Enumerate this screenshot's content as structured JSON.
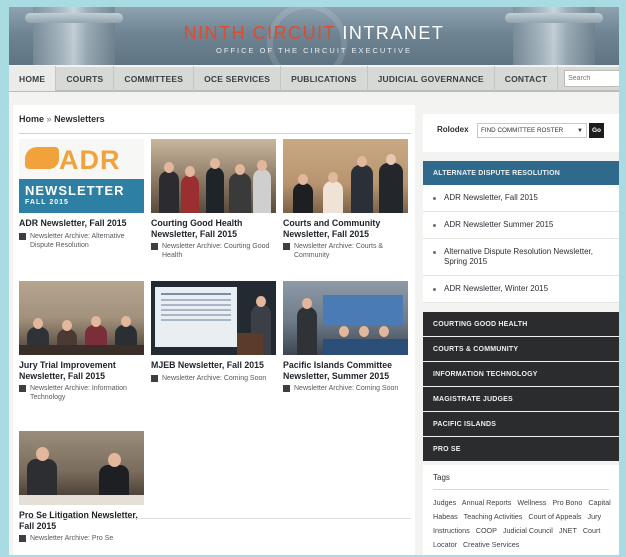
{
  "header": {
    "title_red": "NINTH CIRCUIT",
    "title_white": "INTRANET",
    "subtitle": "OFFICE OF THE CIRCUIT EXECUTIVE"
  },
  "nav": {
    "items": [
      "HOME",
      "COURTS",
      "COMMITTEES",
      "OCE SERVICES",
      "PUBLICATIONS",
      "JUDICIAL GOVERNANCE",
      "CONTACT"
    ],
    "search_placeholder": "Search"
  },
  "breadcrumb": {
    "home": "Home",
    "sep": "»",
    "current": "Newsletters"
  },
  "cards": [
    {
      "title": "ADR Newsletter, Fall 2015",
      "meta": "Newsletter Archive: Alternative Dispute Resolution",
      "thumb": {
        "adr": "ADR",
        "newsletter": "NEWSLETTER",
        "fall": "FALL 2015"
      }
    },
    {
      "title": "Courting Good Health Newsletter, Fall 2015",
      "meta": "Newsletter Archive: Courting Good Health"
    },
    {
      "title": "Courts and Community Newsletter, Fall 2015",
      "meta": "Newsletter Archive: Courts & Community"
    },
    {
      "title": "Jury Trial Improvement Newsletter, Fall 2015",
      "meta": "Newsletter Archive: Information Technology"
    },
    {
      "title": "MJEB Newsletter, Fall 2015",
      "meta": "Newsletter Archive: Coming Soon"
    },
    {
      "title": "Pacific Islands Committee Newsletter, Summer 2015",
      "meta": "Newsletter Archive: Coming Soon"
    },
    {
      "title": "Pro Se Litigation Newsletter, Fall 2015",
      "meta": "Newsletter Archive: Pro Se"
    }
  ],
  "sidebar": {
    "rolodex_label": "Rolodex",
    "rolodex_select": "FIND COMMITTEE ROSTER",
    "go": "Go",
    "open_section": "ALTERNATE DISPUTE RESOLUTION",
    "open_items": [
      "ADR Newsletter, Fall 2015",
      "ADR Newsletter Summer 2015",
      "Alternative Dispute Resolution Newsletter, Spring 2015",
      "ADR Newsletter, Winter 2015"
    ],
    "sections": [
      "COURTING GOOD HEALTH",
      "COURTS & COMMUNITY",
      "INFORMATION TECHNOLOGY",
      "MAGISTRATE JUDGES",
      "PACIFIC ISLANDS",
      "PRO SE"
    ],
    "tags_title": "Tags",
    "tags": [
      "Judges",
      "Annual Reports",
      "Wellness",
      "Pro Bono",
      "Capital Habeas",
      "Teaching Activities",
      "Court of Appeals",
      "Jury Instructions",
      "COOP",
      "Judicial Council",
      "JNET",
      "Court Locator",
      "Creative Services"
    ]
  },
  "colors": {
    "accent_red": "#e04a2e",
    "open_section": "#2f6a8c",
    "dark_section": "#2a2c2e",
    "outer_bg": "#a9dbe3"
  },
  "icons": [
    "search-icon",
    "dropdown-arrow-icon",
    "archive-icon",
    "bullet-icon"
  ]
}
